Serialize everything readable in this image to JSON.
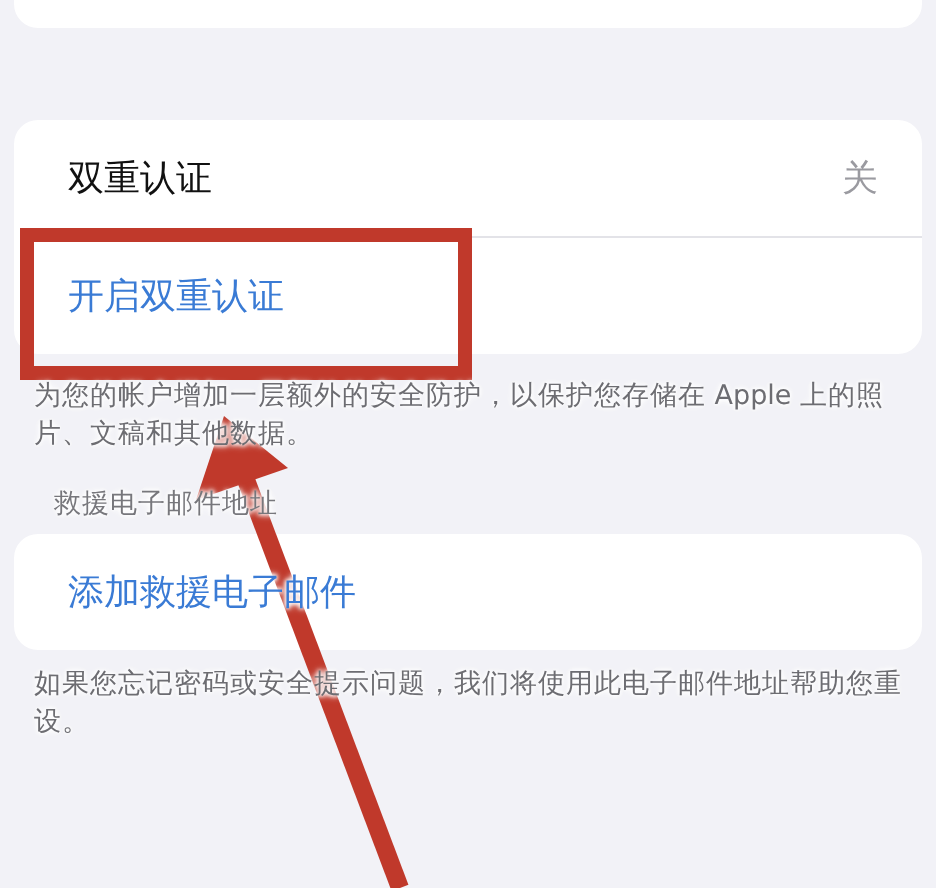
{
  "two_factor": {
    "title": "双重认证",
    "value": "关",
    "action": "开启双重认证",
    "footer": "为您的帐户增加一层额外的安全防护，以保护您存储在 Apple 上的照片、文稿和其他数据。"
  },
  "rescue_email": {
    "header": "救援电子邮件地址",
    "action": "添加救援电子邮件",
    "footer": "如果您忘记密码或安全提示问题，我们将使用此电子邮件地址帮助您重设。"
  },
  "annotations": {
    "highlight_box": true,
    "arrow": true
  }
}
